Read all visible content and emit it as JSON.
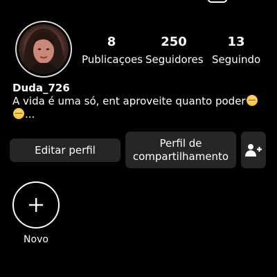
{
  "profile": {
    "username": "Duda_726",
    "bio_line1": "A vida é uma só, ent aproveite quanto poder",
    "bio_line2": "..."
  },
  "stats": {
    "posts": {
      "value": "8",
      "label": "Publicaçoes"
    },
    "followers": {
      "value": "250",
      "label": "Seguidores"
    },
    "following": {
      "value": "13",
      "label": "Seguindo"
    }
  },
  "actions": {
    "edit_label": "Editar perfil",
    "share_label": "Perfil de compartilhamento",
    "add_person_icon": "add-person-icon"
  },
  "highlights": {
    "new_label": "Novo",
    "new_icon": "plus-icon"
  },
  "colors": {
    "background": "#000000",
    "button": "#262626",
    "text": "#ffffff"
  }
}
